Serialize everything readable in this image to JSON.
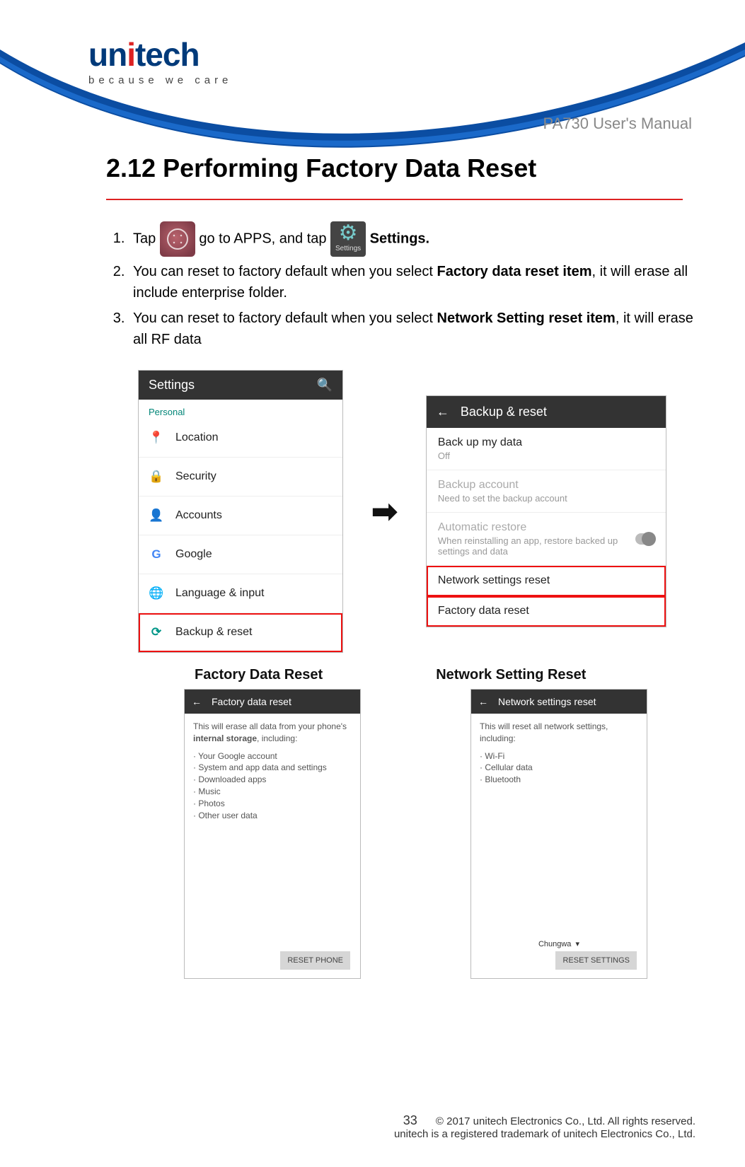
{
  "logo": {
    "name_left": "un",
    "name_dot": "i",
    "name_right": "tech",
    "tagline": "because we care"
  },
  "doc_title": "PA730 User's Manual",
  "section_heading": "2.12 Performing Factory Data Reset",
  "steps": {
    "s1_a": "Tap ",
    "s1_b": " go to APPS, and tap ",
    "s1_c": " Settings.",
    "s2_a": "You can reset to factory default when you select ",
    "s2_b": "Factory data reset item",
    "s2_c": ", it will erase all include enterprise folder.",
    "s3_a": "You can reset to factory default when you select ",
    "s3_b": "Network Setting reset item",
    "s3_c": ", it will erase all RF data"
  },
  "icons": {
    "settings_label": "Settings"
  },
  "settings_screen": {
    "title": "Settings",
    "section": "Personal",
    "items": [
      {
        "icon": "📍",
        "label": "Location",
        "color": "#009688"
      },
      {
        "icon": "🔒",
        "label": "Security",
        "color": "#009688"
      },
      {
        "icon": "👤",
        "label": "Accounts",
        "color": "#009688"
      },
      {
        "icon": "G",
        "label": "Google",
        "color": "#4285F4"
      },
      {
        "icon": "🌐",
        "label": "Language & input",
        "color": "#009688"
      },
      {
        "icon": "⟳",
        "label": "Backup & reset",
        "color": "#009688",
        "highlight": true
      }
    ]
  },
  "backup_screen": {
    "title": "Backup & reset",
    "items": [
      {
        "label": "Back up my data",
        "sub": "Off"
      },
      {
        "label": "Backup account",
        "sub": "Need to set the backup account",
        "disabled": true
      },
      {
        "label": "Automatic restore",
        "sub": "When reinstalling an app, restore backed up settings and data",
        "disabled": true,
        "toggle": true
      },
      {
        "label": "Network settings reset",
        "highlight": true
      },
      {
        "label": "Factory data reset",
        "highlight": true
      }
    ]
  },
  "captions": {
    "left": "Factory Data Reset",
    "right": "Network Setting Reset"
  },
  "fdr_screen": {
    "title": "Factory data reset",
    "lead": "This will erase all data from your phone's internal storage, including:",
    "bullets": [
      "Your Google account",
      "System and app data and settings",
      "Downloaded apps",
      "Music",
      "Photos",
      "Other user data"
    ],
    "button": "RESET PHONE"
  },
  "nsr_screen": {
    "title": "Network settings reset",
    "lead": "This will reset all network settings, including:",
    "bullets": [
      "Wi-Fi",
      "Cellular data",
      "Bluetooth"
    ],
    "carrier": "Chungwa",
    "button": "RESET SETTINGS"
  },
  "footer": {
    "page": "33",
    "line1": "© 2017 unitech Electronics Co., Ltd. All rights reserved.",
    "line2": "unitech is a registered trademark of unitech Electronics Co., Ltd."
  }
}
